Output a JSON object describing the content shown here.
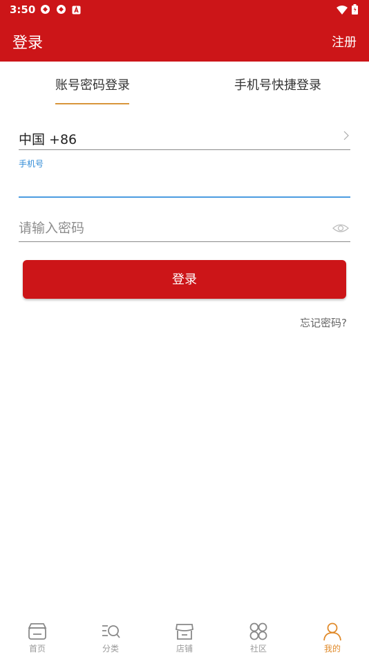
{
  "status_bar": {
    "time": "3:50"
  },
  "app_bar": {
    "title": "登录",
    "register": "注册"
  },
  "tabs": [
    {
      "label": "账号密码登录",
      "active": true
    },
    {
      "label": "手机号快捷登录",
      "active": false
    }
  ],
  "form": {
    "country": "中国 +86",
    "phone_label": "手机号",
    "phone_value": "",
    "password_placeholder": "请输入密码",
    "login_button": "登录",
    "forgot_password": "忘记密码?"
  },
  "bottom_nav": [
    {
      "label": "首页",
      "icon": "store-icon",
      "active": false
    },
    {
      "label": "分类",
      "icon": "category-search-icon",
      "active": false
    },
    {
      "label": "店铺",
      "icon": "shop-icon",
      "active": false
    },
    {
      "label": "社区",
      "icon": "community-icon",
      "active": false
    },
    {
      "label": "我的",
      "icon": "user-icon",
      "active": true
    }
  ],
  "colors": {
    "brand_red": "#cc1518",
    "accent_orange": "#d8953a",
    "focus_blue": "#4a9be0"
  }
}
